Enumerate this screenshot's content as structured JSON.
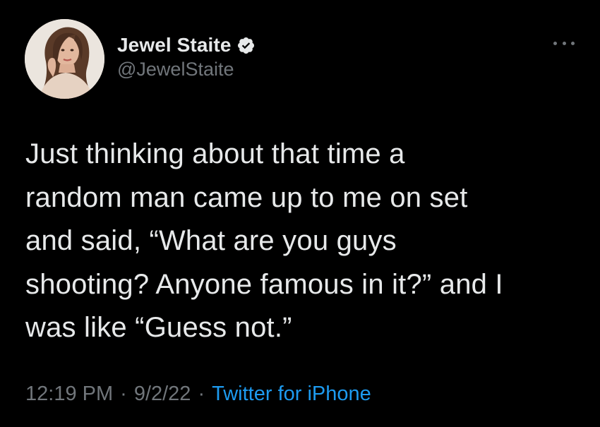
{
  "tweet": {
    "author": {
      "display_name": "Jewel Staite",
      "handle": "@JewelStaite",
      "verified": true,
      "avatar_icon": "profile-photo"
    },
    "text": "Just thinking about that time a\nrandom man came up to me on set\nand said, “What are you guys\nshooting? Anyone famous in it?” and I\nwas like “Guess not.”",
    "time": "12:19 PM",
    "separator": "·",
    "date": "9/2/22",
    "source": "Twitter for iPhone"
  },
  "colors": {
    "background": "#000000",
    "text_primary": "#e7e9ea",
    "text_secondary": "#71767b",
    "accent": "#1d9bf0"
  },
  "icons": {
    "more": "more-horizontal-icon",
    "verified": "verified-badge-icon"
  }
}
